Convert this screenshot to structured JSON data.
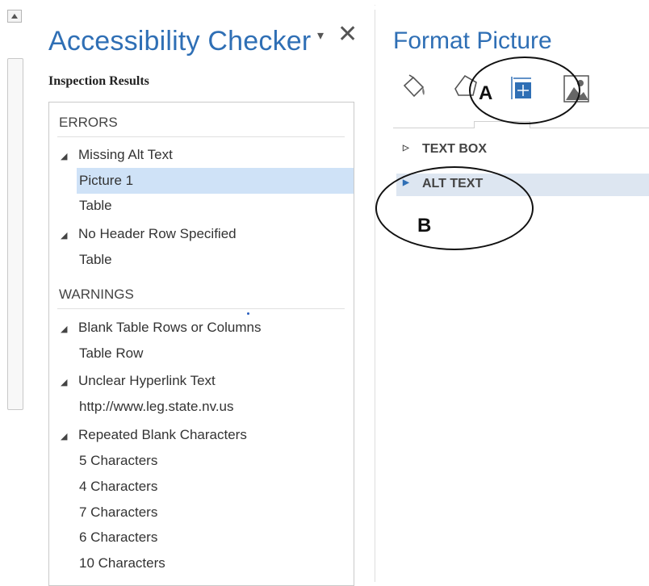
{
  "accessibility_checker": {
    "title": "Accessibility Checker",
    "dropdown_icon": "▾",
    "close_icon": "✕",
    "subtitle": "Inspection Results",
    "errors_header": "ERRORS",
    "warnings_header": "WARNINGS",
    "errors": [
      {
        "category": "Missing Alt Text",
        "items": [
          "Picture 1",
          "Table"
        ]
      },
      {
        "category": "No Header Row Specified",
        "items": [
          "Table"
        ]
      }
    ],
    "warnings": [
      {
        "category": "Blank Table Rows or Columns",
        "items": [
          "Table Row"
        ]
      },
      {
        "category": "Unclear Hyperlink Text",
        "items": [
          "http://www.leg.state.nv.us"
        ]
      },
      {
        "category": "Repeated Blank Characters",
        "items": [
          "5 Characters",
          "4 Characters",
          "7 Characters",
          "6 Characters",
          "10 Characters"
        ]
      }
    ],
    "selected_item": "Picture 1"
  },
  "format_picture": {
    "title": "Format Picture",
    "tabs": [
      "fill-line-icon",
      "effects-icon",
      "size-properties-icon",
      "picture-icon"
    ],
    "sections": [
      {
        "label": "TEXT BOX",
        "expanded": false
      },
      {
        "label": "ALT TEXT",
        "expanded": false,
        "highlighted": true
      }
    ]
  },
  "callouts": {
    "a": "A",
    "b": "B"
  },
  "colors": {
    "accent": "#2f6fb5",
    "selection": "#cfe2f7",
    "alt_highlight": "#dde6f1"
  }
}
